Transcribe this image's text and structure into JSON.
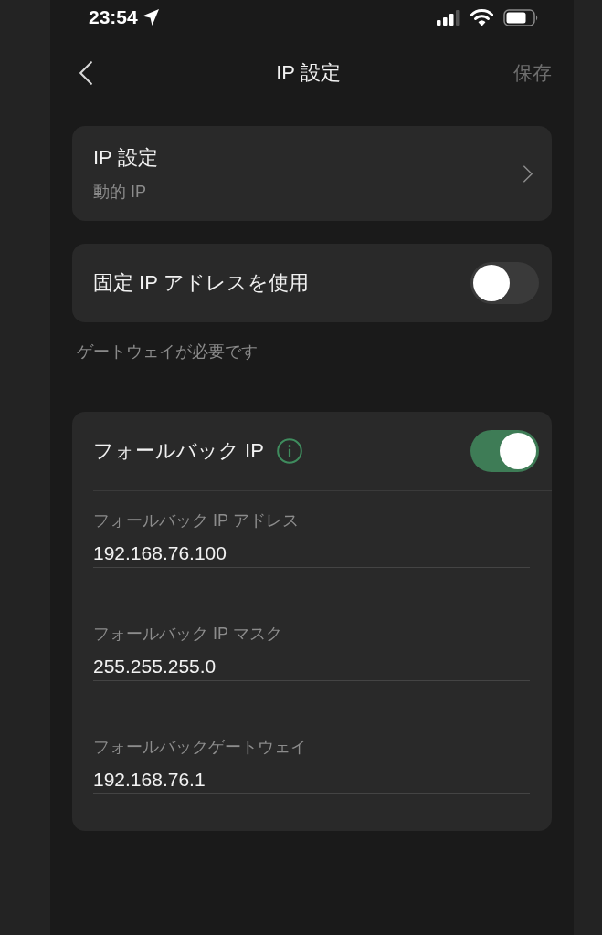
{
  "status_bar": {
    "time": "23:54"
  },
  "nav": {
    "title": "IP 設定",
    "save": {
      "label": "保存",
      "disabled": true
    }
  },
  "ip_setting": {
    "title": "IP 設定",
    "value": "動的 IP"
  },
  "static_ip": {
    "label": "固定 IP アドレスを使用",
    "on": false
  },
  "note": "ゲートウェイが必要です",
  "fallback": {
    "title": "フォールバック IP",
    "on": true,
    "fields": [
      {
        "label": "フォールバック IP アドレス",
        "value": "192.168.76.100"
      },
      {
        "label": "フォールバック IP マスク",
        "value": "255.255.255.0"
      },
      {
        "label": "フォールバックゲートウェイ",
        "value": "192.168.76.1"
      }
    ]
  }
}
